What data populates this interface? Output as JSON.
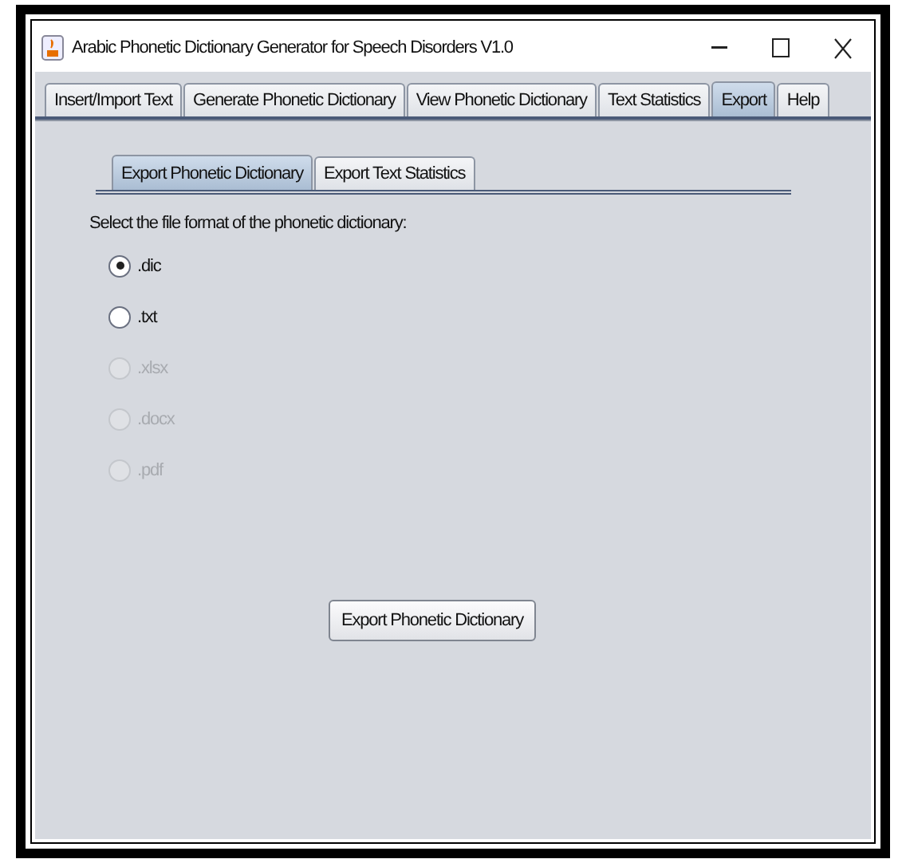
{
  "window": {
    "title": "Arabic Phonetic Dictionary Generator for Speech Disorders V1.0"
  },
  "tabs": [
    {
      "label": "Insert/Import Text",
      "selected": false
    },
    {
      "label": "Generate Phonetic Dictionary",
      "selected": false
    },
    {
      "label": "View Phonetic Dictionary",
      "selected": false
    },
    {
      "label": "Text Statistics",
      "selected": false
    },
    {
      "label": "Export",
      "selected": true
    },
    {
      "label": "Help",
      "selected": false
    }
  ],
  "subtabs": [
    {
      "label": "Export Phonetic Dictionary",
      "selected": true
    },
    {
      "label": "Export Text Statistics",
      "selected": false
    }
  ],
  "prompt": "Select the file format of the phonetic dictionary:",
  "formats": [
    {
      "label": ".dic",
      "selected": true,
      "disabled": false
    },
    {
      "label": ".txt",
      "selected": false,
      "disabled": false
    },
    {
      "label": ".xlsx",
      "selected": false,
      "disabled": true
    },
    {
      "label": ".docx",
      "selected": false,
      "disabled": true
    },
    {
      "label": ".pdf",
      "selected": false,
      "disabled": true
    }
  ],
  "export_button": "Export Phonetic Dictionary"
}
